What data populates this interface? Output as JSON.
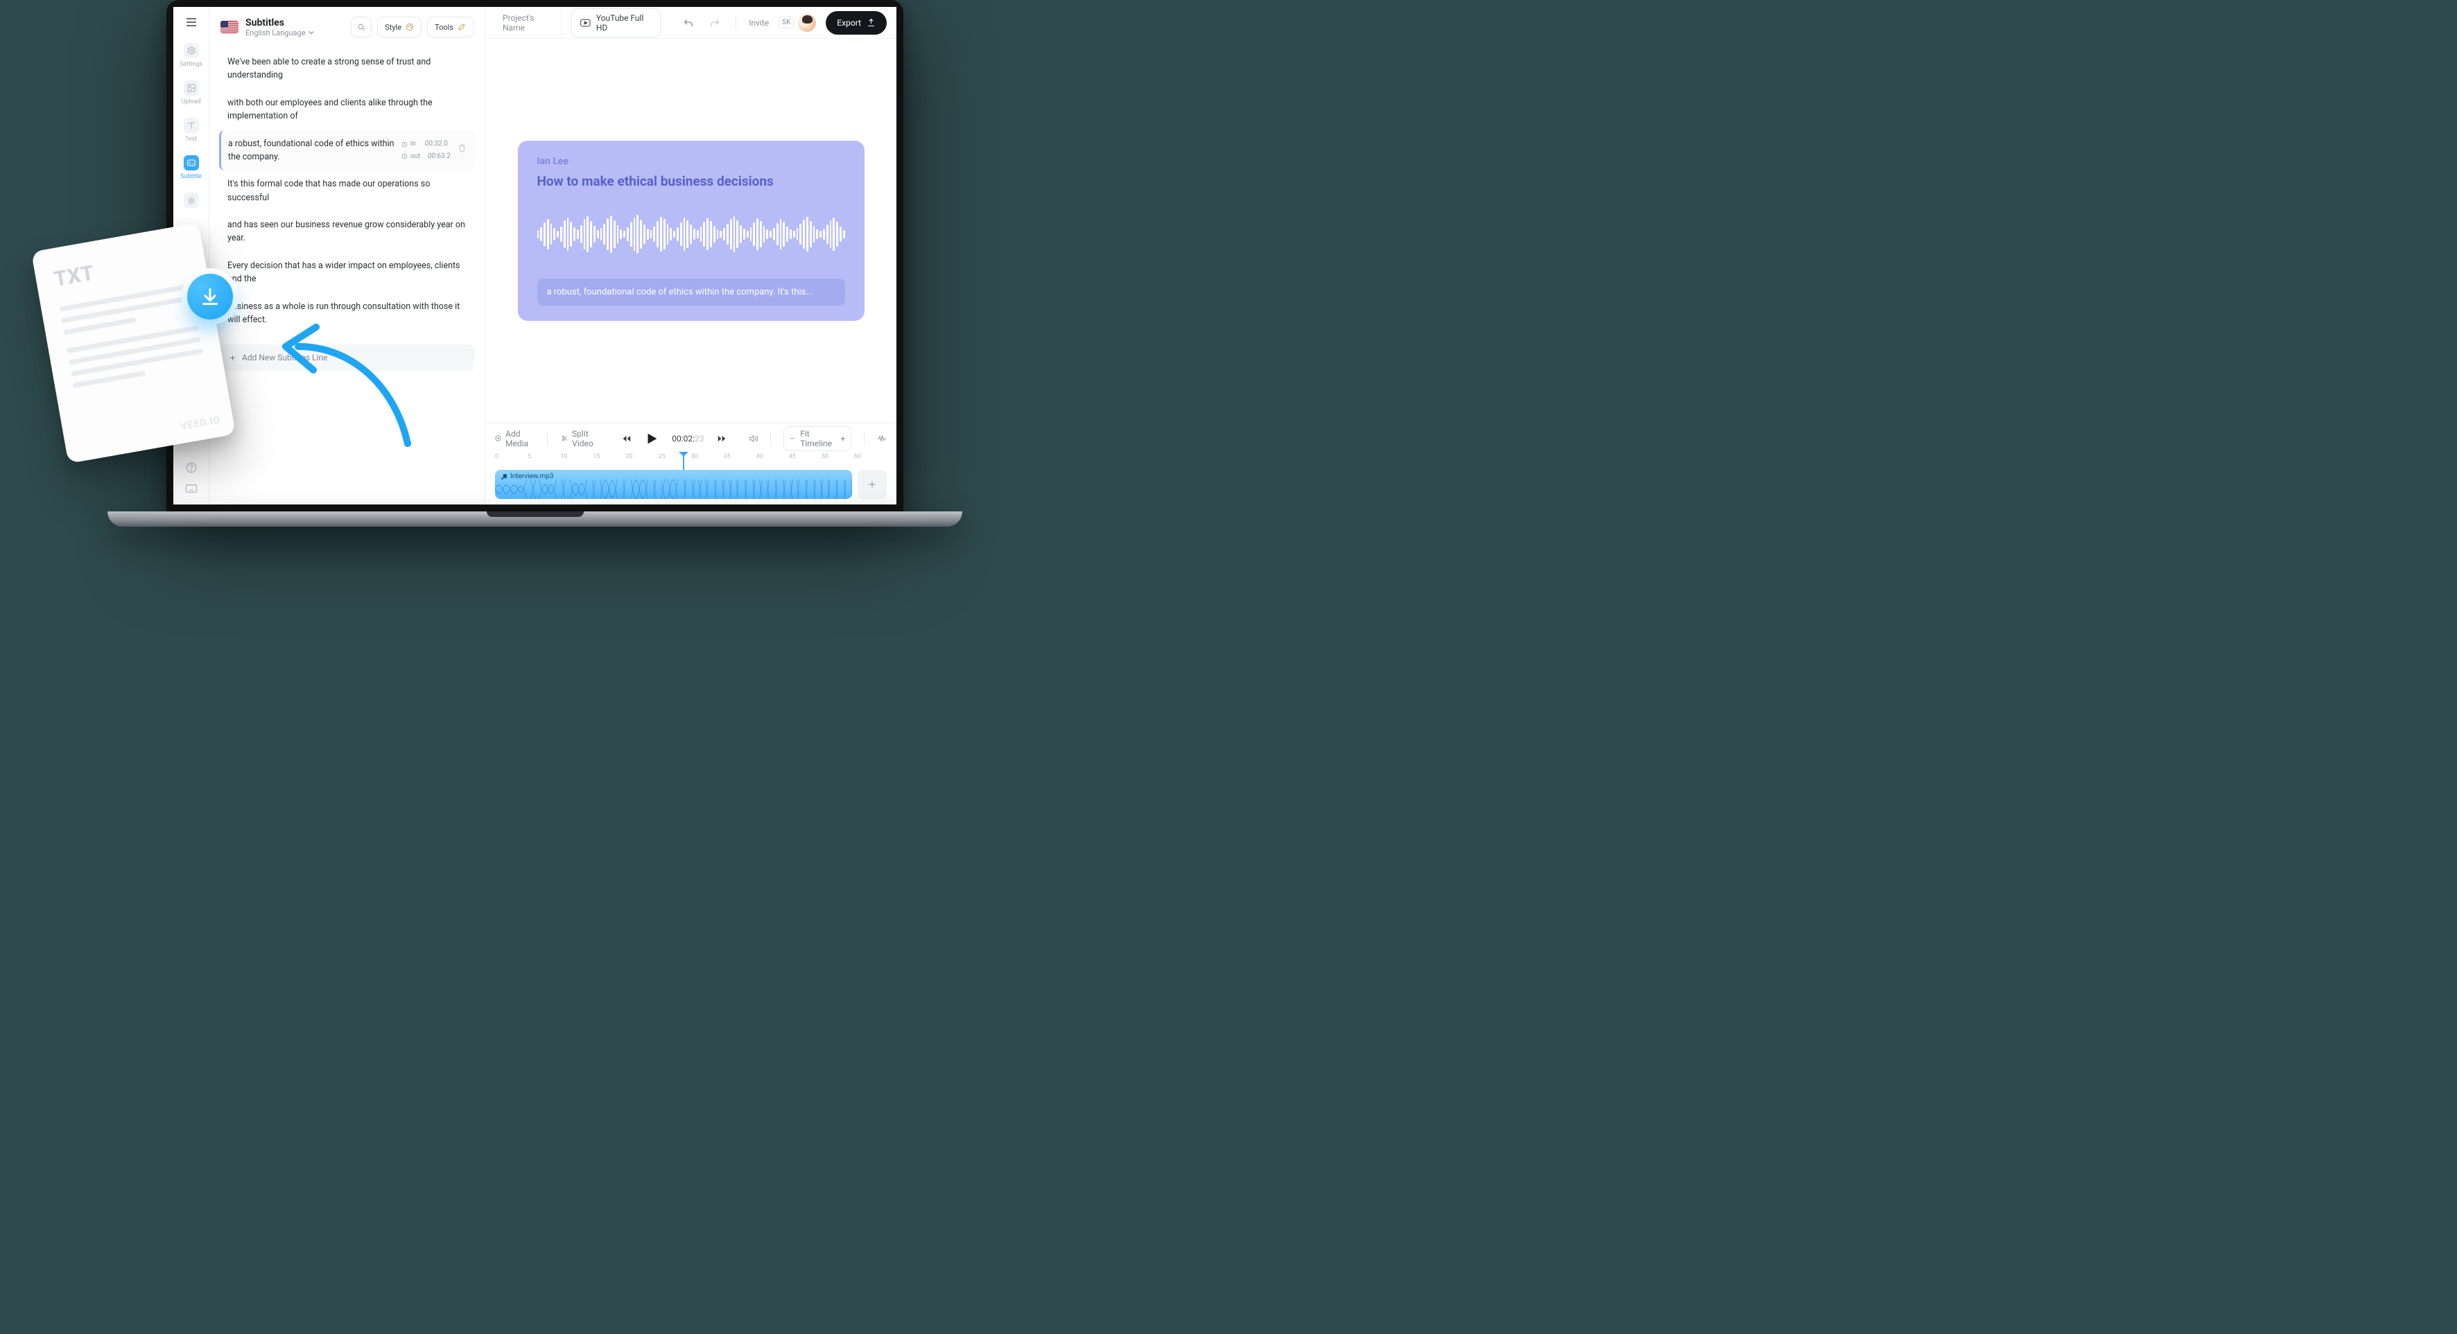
{
  "sidebar": {
    "items": [
      {
        "label": "Settings",
        "icon": "gear-icon"
      },
      {
        "label": "Upload",
        "icon": "image-icon"
      },
      {
        "label": "Text",
        "icon": "text-icon"
      },
      {
        "label": "Subtitle",
        "icon": "subtitle-icon"
      }
    ]
  },
  "panel": {
    "title": "Subtitles",
    "subtitle": "English Language",
    "style_btn": "Style",
    "tools_btn": "Tools",
    "add_line": "Add New Subtitles Line",
    "lines": [
      "We've been able to create a strong sense of trust and understanding",
      "with both our employees and clients alike through the implementation of",
      "a robust, foundational code of ethics within the company.",
      "It's this formal code that has made our operations so successful",
      "and has seen our business revenue grow considerably year on year.",
      "Every decision that has a wider impact on employees, clients and the",
      "business as a whole is run through consultation with those it will effect."
    ],
    "selected_index": 2,
    "in_label": "in",
    "out_label": "out",
    "in_time": "00:32.0",
    "out_time": "00:63.2"
  },
  "topbar": {
    "project": "Project's Name",
    "format": "YouTube Full HD",
    "invite": "Invite",
    "badge": "SK",
    "export": "Export"
  },
  "preview": {
    "author": "Ian Lee",
    "title": "How to make ethical business decisions",
    "subtitle": "a robust, foundational code of ethics within the company. It's this..."
  },
  "playbar": {
    "add_media": "Add Media",
    "split": "Split Video",
    "time_main": "00:02:",
    "time_sec": "23",
    "fit": "Fit Timeline"
  },
  "timeline": {
    "ticks": [
      "0",
      "5",
      "10",
      "15",
      "20",
      "25",
      "30",
      "35",
      "40",
      "45",
      "50",
      "60"
    ],
    "clip_name": "Interview.mp3"
  },
  "overlay": {
    "txt": "TXT",
    "brand": "VEED.IO"
  }
}
